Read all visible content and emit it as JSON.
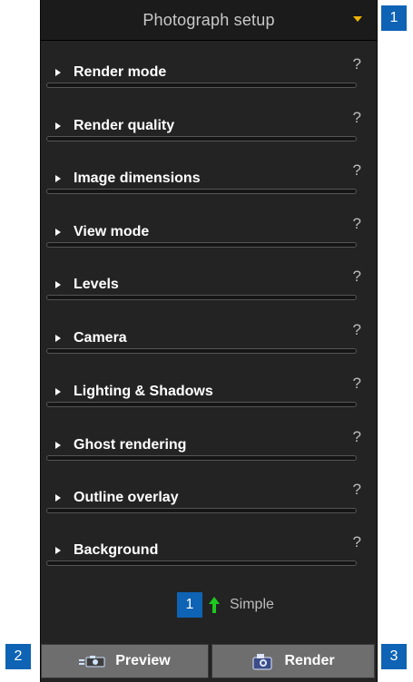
{
  "header": {
    "title": "Photograph setup"
  },
  "sections": [
    {
      "label": "Render mode",
      "help": "?"
    },
    {
      "label": "Render quality",
      "help": "?"
    },
    {
      "label": "Image dimensions",
      "help": "?"
    },
    {
      "label": "View mode",
      "help": "?"
    },
    {
      "label": "Levels",
      "help": "?"
    },
    {
      "label": "Camera",
      "help": "?"
    },
    {
      "label": "Lighting & Shadows",
      "help": "?"
    },
    {
      "label": "Ghost rendering",
      "help": "?"
    },
    {
      "label": "Outline overlay",
      "help": "?"
    },
    {
      "label": "Background",
      "help": "?"
    }
  ],
  "simple_toggle": {
    "label": "Simple",
    "badge": "1"
  },
  "buttons": {
    "preview": "Preview",
    "render": "Render"
  },
  "callouts": {
    "header": "1",
    "preview": "2",
    "render": "3"
  },
  "icons": {
    "expand": "triangle-right-icon",
    "dropdown": "chevron-down-icon",
    "up": "up-arrow-icon",
    "preview": "camera-icon",
    "render": "render-camera-icon"
  },
  "colors": {
    "panel": "#232323",
    "accent_badge": "#0e63b5",
    "arrow_green": "#1ec81e",
    "dropdown_arrow": "#f0b400"
  }
}
